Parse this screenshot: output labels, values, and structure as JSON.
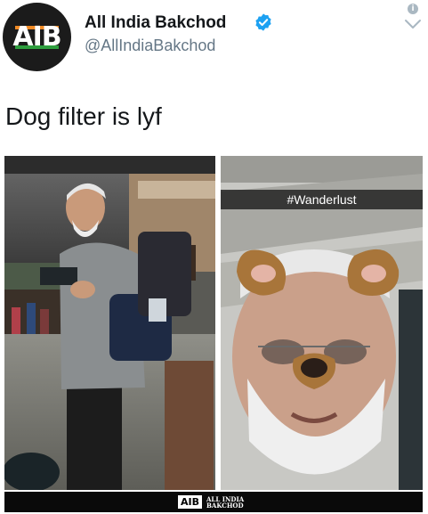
{
  "account": {
    "avatar_logo": "AIB",
    "display_name": "All India Bakchod",
    "handle": "@AllIndiaBakchod"
  },
  "tweet": {
    "text": "Dog filter is lyf"
  },
  "media": {
    "right_caption": "#Wanderlust",
    "footer_logo": "AIB",
    "footer_name": "ALL INDIA BAKCHOD"
  },
  "colors": {
    "verified": "#1da1f2",
    "handle": "#657786",
    "logo_orange": "#f08a24",
    "logo_green": "#2e9e3e"
  }
}
